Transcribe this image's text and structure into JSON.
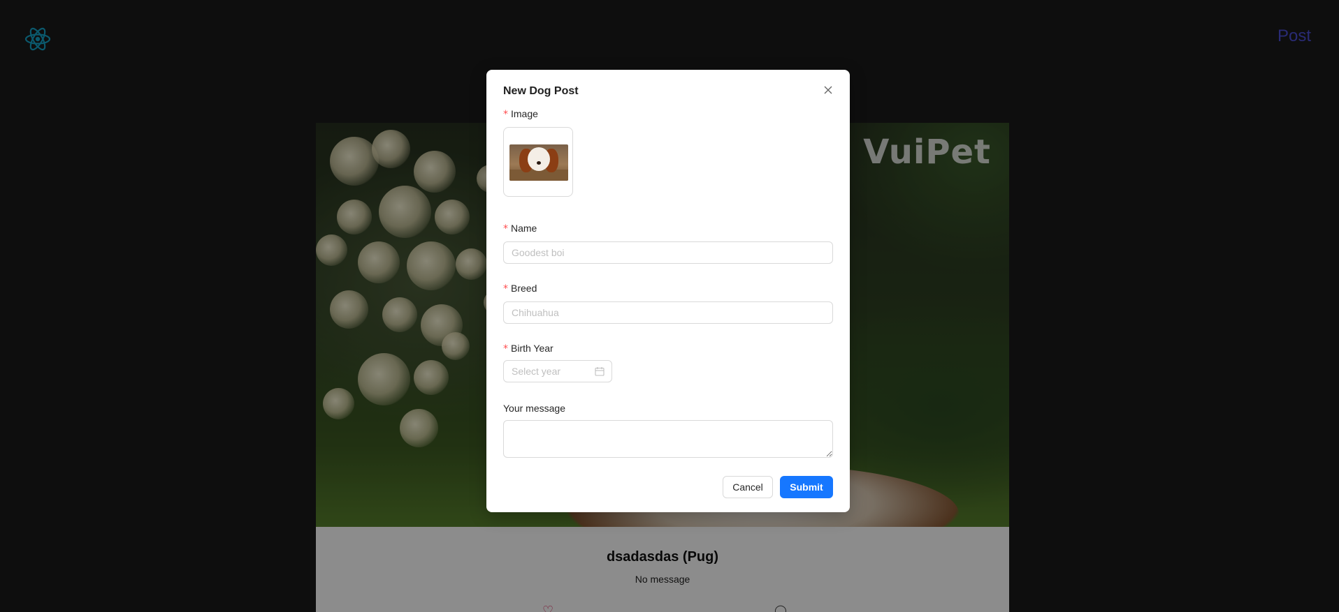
{
  "header": {
    "logo_icon": "react-atom-icon",
    "post_link": "Post",
    "post_link_color": "#4b4fd6"
  },
  "card": {
    "watermark": "VuiPet",
    "title": "dsadasdas (Pug)",
    "message": "No message",
    "like_icon": "heart-icon",
    "comment_icon": "comment-icon"
  },
  "modal": {
    "title": "New Dog Post",
    "close_icon": "close-icon",
    "image_label": "Image",
    "image_thumbnail": "dog-photo-thumbnail",
    "name_label": "Name",
    "name_placeholder": "Goodest boi",
    "name_value": "",
    "breed_label": "Breed",
    "breed_placeholder": "Chihuahua",
    "breed_value": "",
    "birth_year_label": "Birth Year",
    "birth_year_placeholder": "Select year",
    "calendar_icon": "calendar-icon",
    "message_label": "Your message",
    "message_value": "",
    "required_mark": "*",
    "cancel_label": "Cancel",
    "submit_label": "Submit",
    "submit_color": "#1677ff",
    "required_color": "#ff4d4f"
  }
}
